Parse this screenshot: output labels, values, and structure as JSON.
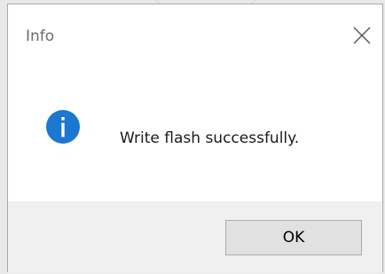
{
  "dialog": {
    "title": "Info",
    "icon": "info-icon",
    "message": "Write flash successfully.",
    "ok_label": "OK",
    "close_icon": "close-icon"
  },
  "colors": {
    "info_icon_bg": "#1a77d2",
    "footer_bg": "#f0f0f0",
    "button_bg": "#e1e1e1",
    "button_border": "#adadad"
  }
}
